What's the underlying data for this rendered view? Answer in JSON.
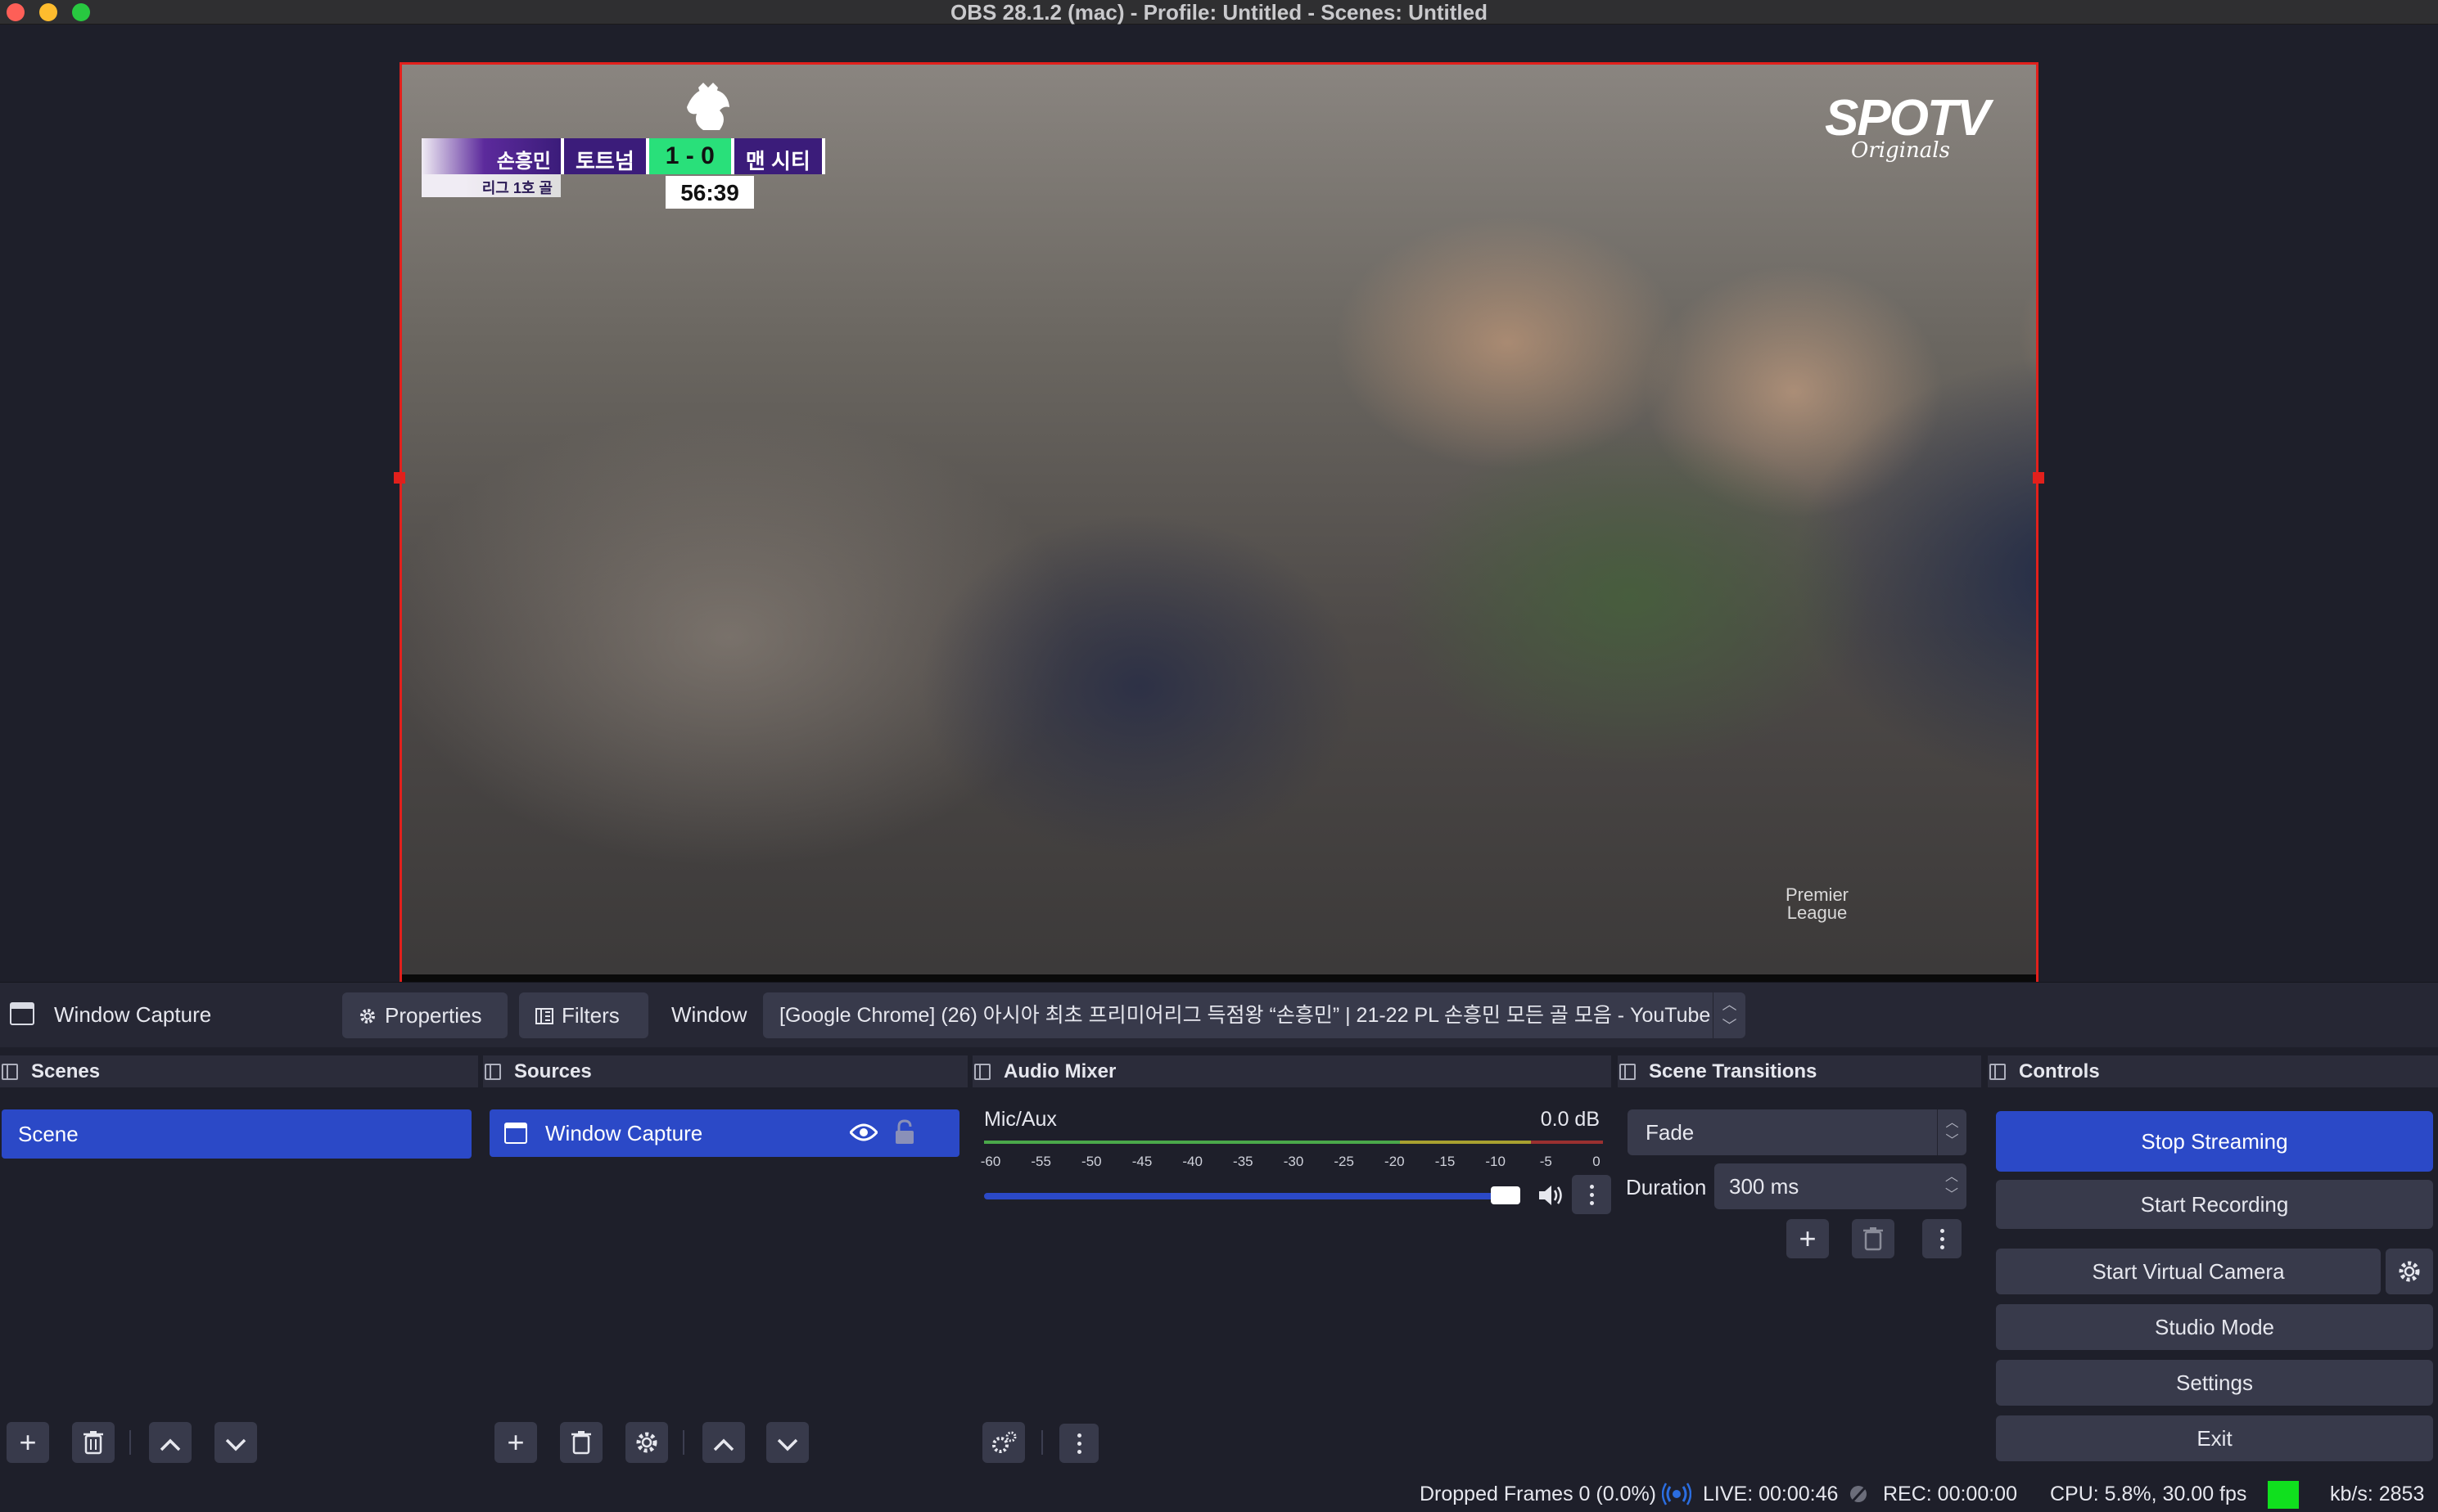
{
  "window": {
    "title": "OBS 28.1.2 (mac) - Profile: Untitled - Scenes: Untitled"
  },
  "preview": {
    "scoreboard": {
      "player": "손흥민",
      "player_sub": "리그 1호 골",
      "home": "토트넘",
      "score": "1 - 0",
      "away": "맨 시티",
      "clock": "56:39"
    },
    "broadcaster": "SPOTV",
    "broadcaster_sub": "Originals",
    "watermark": [
      "Premier",
      "League"
    ]
  },
  "source_toolbar": {
    "source_name": "Window Capture",
    "properties_label": "Properties",
    "filters_label": "Filters",
    "window_label": "Window",
    "window_value": "[Google Chrome] (26) 아시아 최초 프리미어리그 득점왕 “손흥민” | 21-22 PL 손흥민 모든 골 모음 - YouTube"
  },
  "scenes": {
    "title": "Scenes",
    "items": [
      "Scene"
    ]
  },
  "sources": {
    "title": "Sources",
    "items": [
      "Window Capture"
    ]
  },
  "mixer": {
    "title": "Audio Mixer",
    "channel": "Mic/Aux",
    "level": "0.0 dB",
    "scale": [
      "-60",
      "-55",
      "-50",
      "-45",
      "-40",
      "-35",
      "-30",
      "-25",
      "-20",
      "-15",
      "-10",
      "-5",
      "0"
    ],
    "volume_fraction": 0.98
  },
  "transitions": {
    "title": "Scene Transitions",
    "selected": "Fade",
    "duration_label": "Duration",
    "duration_value": "300 ms"
  },
  "controls": {
    "title": "Controls",
    "stop_streaming": "Stop Streaming",
    "start_recording": "Start Recording",
    "start_virtual_camera": "Start Virtual Camera",
    "studio_mode": "Studio Mode",
    "settings": "Settings",
    "exit": "Exit"
  },
  "status": {
    "dropped_frames": "Dropped Frames 0 (0.0%)",
    "live": "LIVE: 00:00:46",
    "rec": "REC: 00:00:00",
    "cpu": "CPU: 5.8%, 30.00 fps",
    "kbs": "kb/s: 2853"
  },
  "colors": {
    "accent": "#2b49c7",
    "selection_border": "#e2201c",
    "stream_ok": "#10e01e",
    "panel": "#2b2c3a",
    "background": "#1e1f2a"
  }
}
